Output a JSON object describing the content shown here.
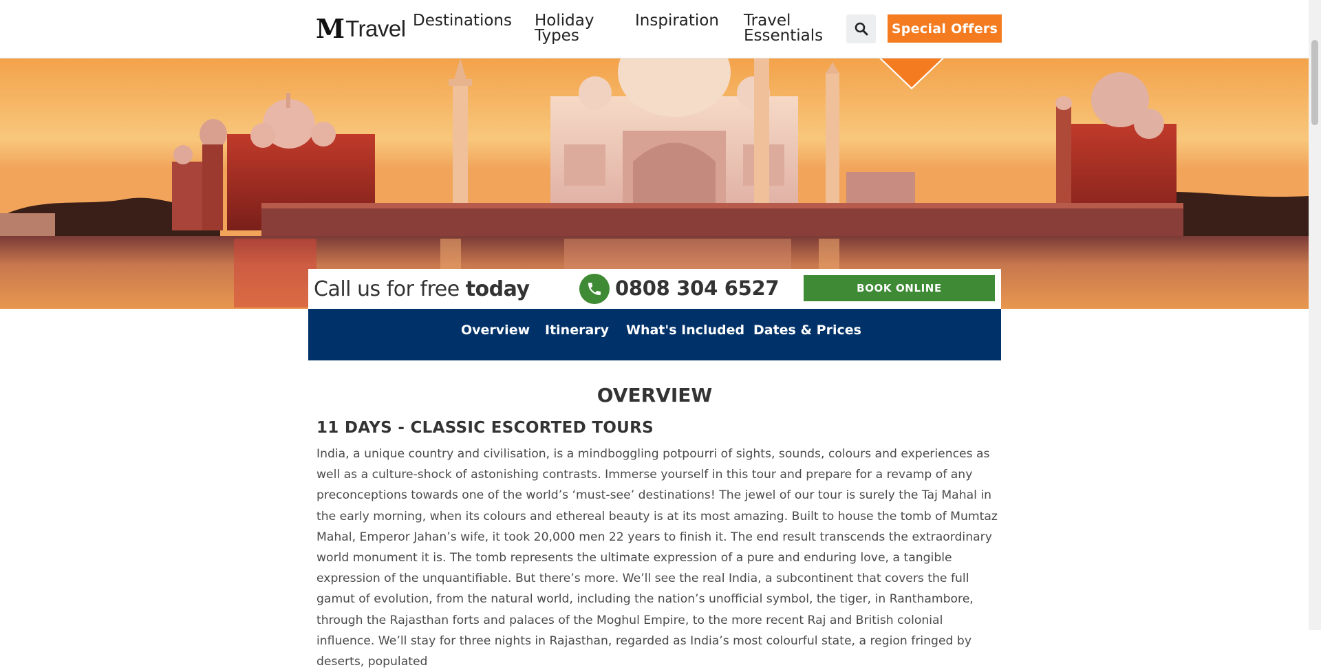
{
  "header": {
    "logo_mark": "M",
    "logo_word": "Travel",
    "nav": {
      "destinations": "Destinations",
      "holiday_types": "Holiday Types",
      "inspiration": "Inspiration",
      "travel_essentials": "Travel Essentials"
    },
    "search_icon": "search-icon",
    "special_offers": "Special Offers"
  },
  "call_bar": {
    "call_prefix": "Call us for free ",
    "call_bold": "today",
    "phone_icon": "phone-icon",
    "phone_number": "0808 304 6527",
    "book_online": "BOOK ONLINE"
  },
  "tabs": {
    "overview": "Overview",
    "itinerary": "Itinerary",
    "whats_included": "What's Included",
    "dates_prices": "Dates & Prices",
    "active": "Overview"
  },
  "content": {
    "section_title": "OVERVIEW",
    "tour_heading": "11 DAYS - CLASSIC ESCORTED TOURS",
    "description": "India, a unique country and civilisation, is a mindboggling potpourri of sights, sounds, colours and experiences as well as a culture-shock of astonishing contrasts. Immerse yourself in this tour and prepare for a revamp of any preconceptions towards one of the world’s ‘must-see’ destinations! The jewel of our tour is surely the Taj Mahal in the early morning, when its colours and ethereal beauty is at its most amazing. Built to house the tomb of Mumtaz Mahal, Emperor Jahan’s wife, it took 20,000 men 22 years to finish it. The end result transcends the extraordinary world monument it is. The tomb represents the ultimate expression of a pure and enduring love, a tangible expression of the unquantifiable. But there’s more. We’ll see the real India, a subcontinent that covers the full gamut of evolution, from the natural world, including the nation’s unofficial symbol, the tiger, in Ranthambore, through the Rajasthan forts and palaces of the Moghul Empire, to the more recent Raj and British colonial influence. We’ll stay for three nights in Rajasthan, regarded as India’s most colourful state, a region fringed by deserts, populated"
  },
  "colors": {
    "accent_orange": "#f47b20",
    "book_green": "#3f8a34",
    "tab_navy": "#003168"
  }
}
